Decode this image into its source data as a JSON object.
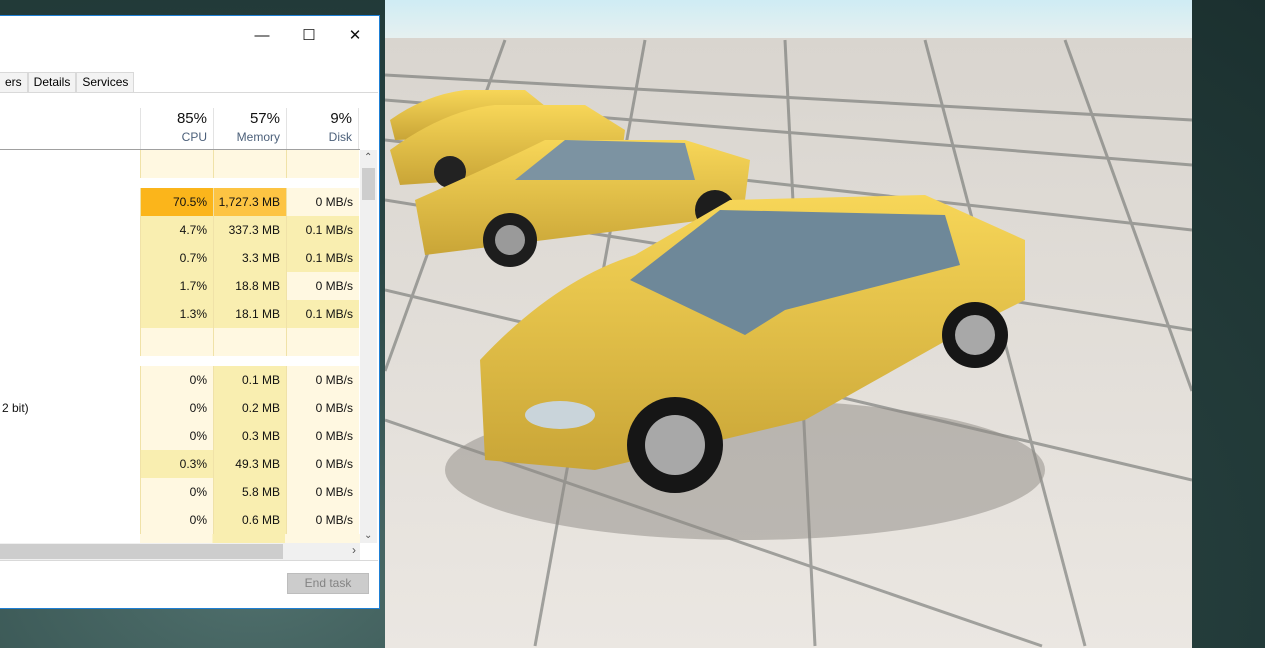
{
  "window": {
    "minimize": "—",
    "maximize": "☐",
    "close": "✕"
  },
  "tabs": [
    "ers",
    "Details",
    "Services"
  ],
  "header": {
    "cpu_pct": "85%",
    "cpu": "CPU",
    "mem_pct": "57%",
    "mem": "Memory",
    "disk_pct": "9%",
    "disk": "Disk"
  },
  "rows": [
    {
      "name": "",
      "cpu": "",
      "mem": "",
      "disk": "",
      "blank": true
    },
    {
      "name": "",
      "cpu": "70.5%",
      "mem": "1,727.3 MB",
      "disk": "0 MB/s"
    },
    {
      "name": "",
      "cpu": "4.7%",
      "mem": "337.3 MB",
      "disk": "0.1 MB/s"
    },
    {
      "name": "",
      "cpu": "0.7%",
      "mem": "3.3 MB",
      "disk": "0.1 MB/s"
    },
    {
      "name": "",
      "cpu": "1.7%",
      "mem": "18.8 MB",
      "disk": "0 MB/s"
    },
    {
      "name": "",
      "cpu": "1.3%",
      "mem": "18.1 MB",
      "disk": "0.1 MB/s"
    },
    {
      "name": "",
      "cpu": "",
      "mem": "",
      "disk": "",
      "blank": true
    },
    {
      "name": "",
      "cpu": "0%",
      "mem": "0.1 MB",
      "disk": "0 MB/s"
    },
    {
      "name": "2 bit)",
      "cpu": "0%",
      "mem": "0.2 MB",
      "disk": "0 MB/s"
    },
    {
      "name": "",
      "cpu": "0%",
      "mem": "0.3 MB",
      "disk": "0 MB/s"
    },
    {
      "name": "",
      "cpu": "0.3%",
      "mem": "49.3 MB",
      "disk": "0 MB/s"
    },
    {
      "name": "",
      "cpu": "0%",
      "mem": "5.8 MB",
      "disk": "0 MB/s"
    },
    {
      "name": "",
      "cpu": "0%",
      "mem": "0.6 MB",
      "disk": "0 MB/s"
    }
  ],
  "end_task": "End task",
  "colors": {
    "light": "#fff8e1",
    "mid": "#f9eeb0",
    "hot": "#fbb51b",
    "warm": "#fdc443",
    "border": "#1e7fd4"
  }
}
